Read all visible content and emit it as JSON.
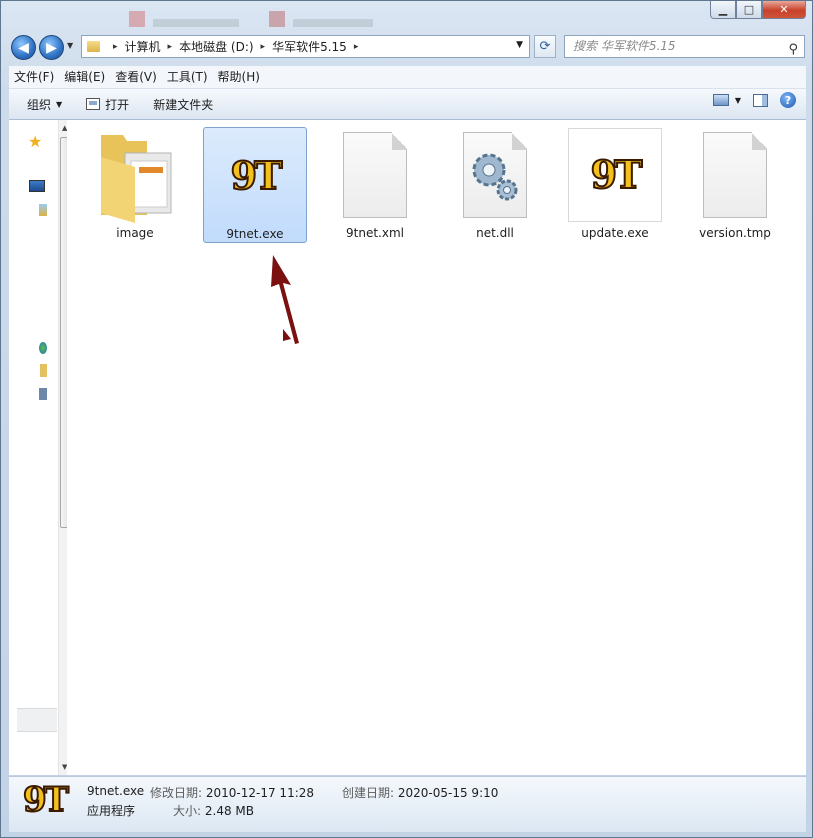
{
  "window": {
    "controls": {
      "minimize": "▁",
      "maximize": "□",
      "close": "✕"
    }
  },
  "nav": {
    "back_icon": "◀",
    "forward_icon": "▶",
    "history_dropdown": "▼",
    "breadcrumb": [
      "计算机",
      "本地磁盘 (D:)",
      "华军软件5.15"
    ],
    "separator": "▸",
    "address_dropdown": "▼",
    "refresh_icon": "⟳",
    "search_placeholder": "搜索 华军软件5.15",
    "search_icon": "⚲"
  },
  "menubar": [
    "文件(F)",
    "编辑(E)",
    "查看(V)",
    "工具(T)",
    "帮助(H)"
  ],
  "toolbar": {
    "organize": "组织",
    "dropdown": "▼",
    "open": "打开",
    "new_folder": "新建文件夹",
    "help_icon": "?"
  },
  "navpane": {
    "favorites_icon": "★"
  },
  "files": [
    {
      "name": "image",
      "type": "folder"
    },
    {
      "name": "9tnet.exe",
      "type": "exe",
      "icon_text": "9T",
      "selected": true
    },
    {
      "name": "9tnet.xml",
      "type": "doc"
    },
    {
      "name": "net.dll",
      "type": "dll"
    },
    {
      "name": "update.exe",
      "type": "exe",
      "icon_text": "9T"
    },
    {
      "name": "version.tmp",
      "type": "doc"
    }
  ],
  "details": {
    "icon_text": "9T",
    "filename": "9tnet.exe",
    "filetype": "应用程序",
    "modified_label": "修改日期:",
    "modified_value": "2010-12-17 11:28",
    "size_label": "大小:",
    "size_value": "2.48 MB",
    "created_label": "创建日期:",
    "created_value": "2020-05-15 9:10"
  },
  "colors": {
    "accent": "#c1dbfc",
    "arrow": "#7a1010",
    "icon_gold": "#f2c11f"
  }
}
